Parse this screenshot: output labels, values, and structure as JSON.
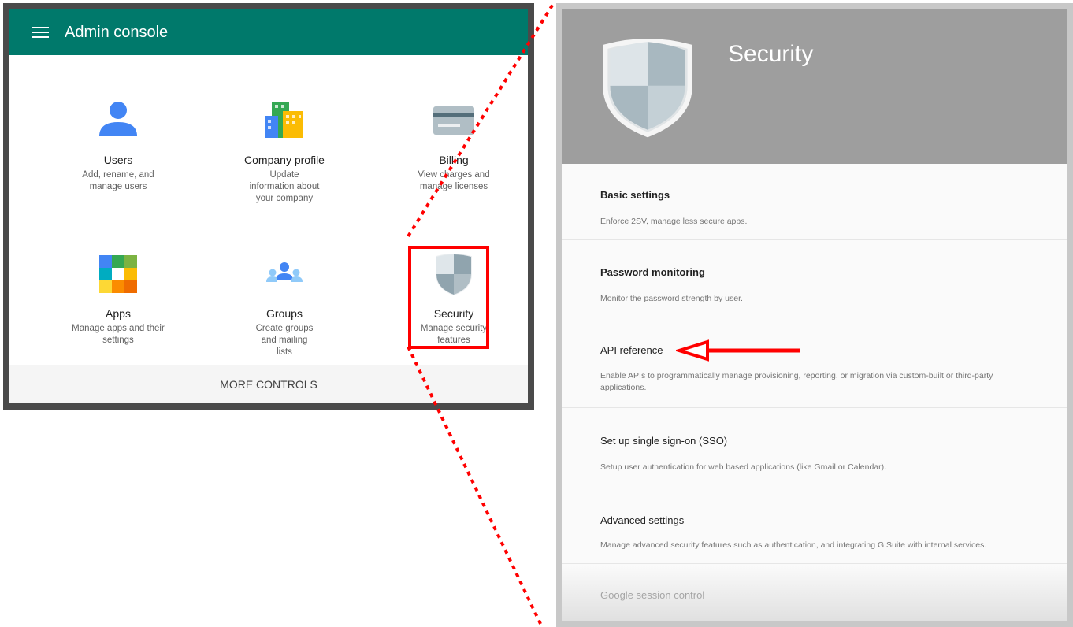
{
  "admin": {
    "title": "Admin console",
    "tiles": [
      {
        "title": "Users",
        "desc": "Add, rename, and manage users",
        "icon": "users-icon"
      },
      {
        "title": "Company profile",
        "desc": "Update information about your company",
        "icon": "company-profile-icon"
      },
      {
        "title": "Billing",
        "desc": "View charges and manage licenses",
        "icon": "billing-icon"
      },
      {
        "title": "Apps",
        "desc": "Manage apps and their settings",
        "icon": "apps-icon"
      },
      {
        "title": "Groups",
        "desc": "Create groups and mailing lists",
        "icon": "groups-icon"
      },
      {
        "title": "Security",
        "desc": "Manage security features",
        "icon": "shield-icon"
      }
    ],
    "more_controls": "MORE CONTROLS"
  },
  "security": {
    "title": "Security",
    "items": [
      {
        "title": "Basic settings",
        "desc": "Enforce 2SV, manage less secure apps."
      },
      {
        "title": "Password monitoring",
        "desc": "Monitor the password strength by user."
      },
      {
        "title": "API reference",
        "desc": "Enable APIs to programmatically manage provisioning, reporting, or migration via custom-built or third-party applications."
      },
      {
        "title": "Set up single sign-on (SSO)",
        "desc": "Setup user authentication for web based applications (like Gmail or Calendar)."
      },
      {
        "title": "Advanced settings",
        "desc": "Manage advanced security features such as authentication, and integrating G Suite with internal services."
      },
      {
        "title": "Google session control",
        "desc": ""
      }
    ]
  },
  "colors": {
    "admin_header": "#00796b",
    "security_header": "#9e9e9e",
    "annotation": "#ff0000"
  }
}
